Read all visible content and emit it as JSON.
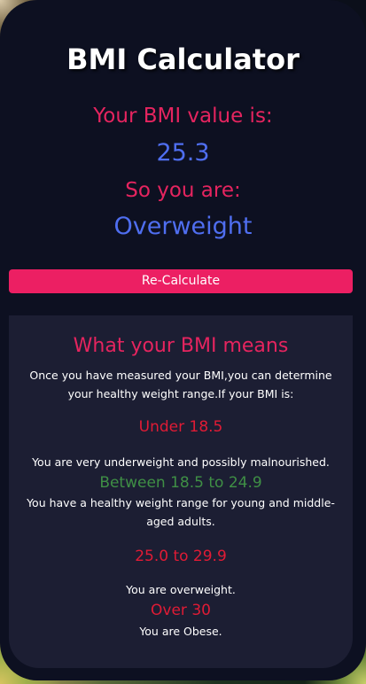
{
  "app": {
    "title": "BMI Calculator"
  },
  "result": {
    "label": "Your BMI value is:",
    "value": "25.3",
    "category_label": "So you are:",
    "category": "Overweight"
  },
  "actions": {
    "recalculate_label": "Re-Calculate"
  },
  "info": {
    "title": "What your BMI means",
    "intro": "Once you have measured your BMI,you can determine your healthy weight range.If your BMI is:",
    "ranges": [
      {
        "range": "Under 18.5",
        "description": "You are very underweight and possibly malnourished."
      },
      {
        "range": "Between 18.5 to 24.9",
        "description": "You have a healthy weight range for young and middle-aged adults."
      },
      {
        "range": "25.0 to 29.9",
        "description": "You are overweight."
      },
      {
        "range": "Over 30",
        "description": "You are Obese."
      }
    ]
  },
  "colors": {
    "accent": "#ec1f63",
    "value_blue": "#4f6ef0",
    "range_red": "#e01b35",
    "range_green": "#3f8f45",
    "card_bg": "#0d1021",
    "panel_bg": "#1c1e33"
  }
}
